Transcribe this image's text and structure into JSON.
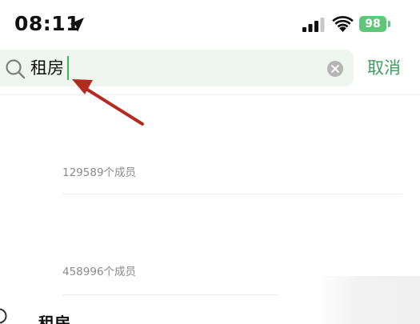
{
  "status_bar": {
    "time": "08:11",
    "battery": "98",
    "location_icon": "location-arrow-icon",
    "signal_icon": "cellular-signal-icon",
    "wifi_icon": "wifi-icon",
    "battery_color": "#5ec77a"
  },
  "search": {
    "query": "租房",
    "icon": "search-icon",
    "clear_icon": "clear-circle-icon",
    "cancel_label": "取消",
    "accent_color": "#3f9d60",
    "cursor_color": "#3cb85c",
    "box_color": "#eef6ef"
  },
  "annotation": {
    "arrow_color": "#b52a1e"
  },
  "results": [
    {
      "members": "129589个成员"
    },
    {
      "members": "458996个成员"
    },
    {
      "title": "租房"
    }
  ]
}
